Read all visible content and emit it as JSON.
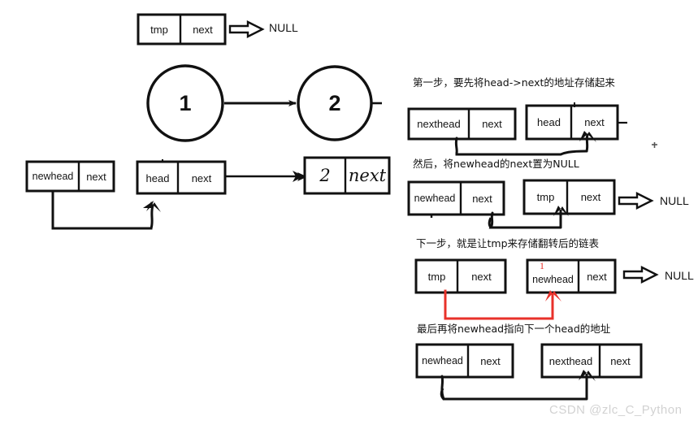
{
  "page": {
    "title": "Linked list reversal hand-drawn explanation",
    "watermark": "CSDN @zlc_C_Python"
  },
  "left_diagram": {
    "tmp_box": {
      "left_label": "tmp",
      "right_label": "next",
      "target": "NULL"
    },
    "nodes": [
      {
        "value": "1"
      },
      {
        "value": "2"
      }
    ],
    "newhead_box": {
      "left_label": "newhead",
      "right_label": "next"
    },
    "head_box": {
      "left_label": "head",
      "right_label": "next"
    },
    "handwritten_box": {
      "left_label": "2",
      "right_label": "next"
    }
  },
  "steps": [
    {
      "id": "step-1",
      "caption": "第一步，要先将head->next的地址存储起来",
      "boxes": [
        {
          "left_label": "nexthead",
          "right_label": "next"
        },
        {
          "left_label": "head",
          "right_label": "next"
        }
      ],
      "null_label": ""
    },
    {
      "id": "step-2",
      "caption": "然后，将newhead的next置为NULL",
      "boxes": [
        {
          "left_label": "newhead",
          "right_label": "next"
        },
        {
          "left_label": "tmp",
          "right_label": "next"
        }
      ],
      "null_label": "NULL"
    },
    {
      "id": "step-3",
      "caption": "下一步，就是让tmp来存储翻转后的链表",
      "boxes": [
        {
          "left_label": "tmp",
          "right_label": "next"
        },
        {
          "left_label": "newhead",
          "right_label": "next",
          "annotation": "1"
        }
      ],
      "null_label": "NULL"
    },
    {
      "id": "step-4",
      "caption": "最后再将newhead指向下一个head的地址",
      "boxes": [
        {
          "left_label": "newhead",
          "right_label": "next"
        },
        {
          "left_label": "nexthead",
          "right_label": "next"
        }
      ],
      "null_label": ""
    }
  ],
  "colors": {
    "ink": "#111111",
    "red": "#e8312a",
    "watermark": "#d2d2d2",
    "background": "#ffffff"
  }
}
